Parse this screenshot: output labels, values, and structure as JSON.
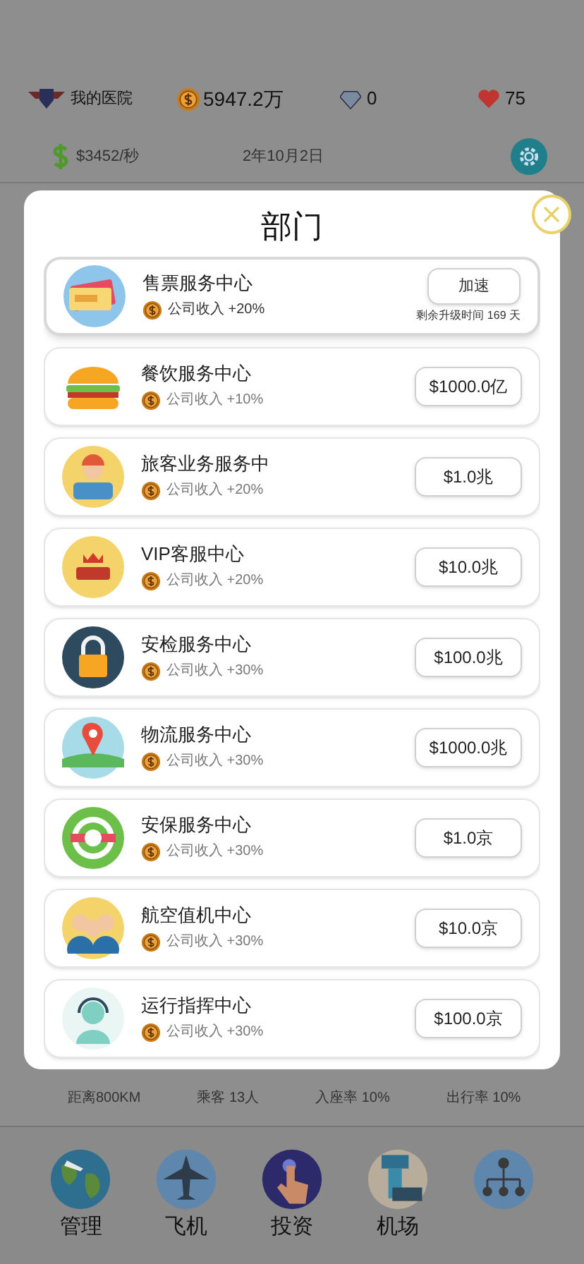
{
  "header": {
    "hospital": "我的医院",
    "coins": "5947.2万",
    "gems": "0",
    "hearts": "75",
    "income": "$3452/秒",
    "date": "2年10月2日"
  },
  "modal": {
    "title": "部门",
    "departments": [
      {
        "name": "售票服务中心",
        "bonus": "公司收入 +20%",
        "kind": "upgrading",
        "action": "加速",
        "note": "剩余升级时间 169 天"
      },
      {
        "name": "餐饮服务中心",
        "bonus": "公司收入 +10%",
        "kind": "buy",
        "action": "$1000.0亿"
      },
      {
        "name": "旅客业务服务中",
        "bonus": "公司收入 +20%",
        "kind": "buy",
        "action": "$1.0兆"
      },
      {
        "name": "VIP客服中心",
        "bonus": "公司收入 +20%",
        "kind": "buy",
        "action": "$10.0兆"
      },
      {
        "name": "安检服务中心",
        "bonus": "公司收入 +30%",
        "kind": "buy",
        "action": "$100.0兆"
      },
      {
        "name": "物流服务中心",
        "bonus": "公司收入 +30%",
        "kind": "buy",
        "action": "$1000.0兆"
      },
      {
        "name": "安保服务中心",
        "bonus": "公司收入 +30%",
        "kind": "buy",
        "action": "$1.0京"
      },
      {
        "name": "航空值机中心",
        "bonus": "公司收入 +30%",
        "kind": "buy",
        "action": "$10.0京"
      },
      {
        "name": "运行指挥中心",
        "bonus": "公司收入 +30%",
        "kind": "buy",
        "action": "$100.0京"
      }
    ]
  },
  "stats": [
    "距离800KM",
    "乘客 13人",
    "入座率 10%",
    "出行率 10%"
  ],
  "nav": [
    {
      "kind": "labeled",
      "label": "管理"
    },
    {
      "kind": "labeled",
      "label": "飞机"
    },
    {
      "kind": "labeled",
      "label": "投资"
    },
    {
      "kind": "labeled",
      "label": "机场"
    },
    {
      "kind": "icon"
    }
  ]
}
